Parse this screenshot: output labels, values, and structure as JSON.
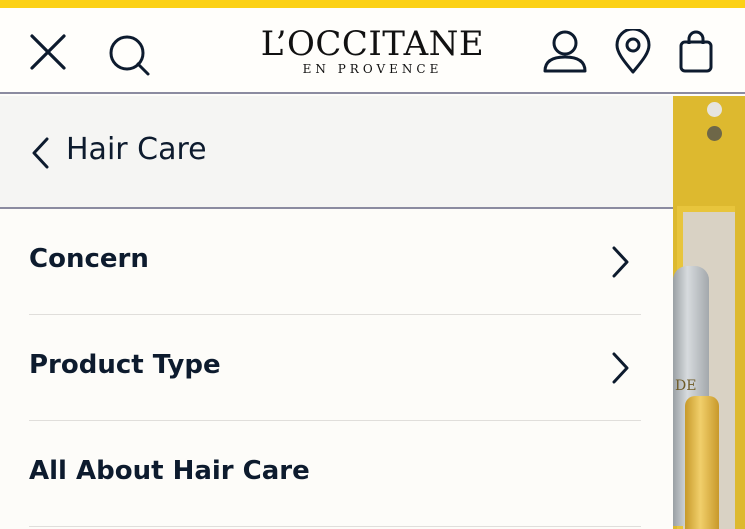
{
  "colors": {
    "accent": "#fcd116",
    "text": "#0d1b2e",
    "panel": "#f5f5f3",
    "divider": "#8b8ba0"
  },
  "header": {
    "logo_main": "L’OCCITANE",
    "logo_sub": "EN PROVENCE",
    "icons": [
      "close-icon",
      "search-icon",
      "account-icon",
      "store-locator-icon",
      "shopping-bag-icon"
    ]
  },
  "drawer": {
    "back_label": "Hair Care",
    "items": [
      {
        "label": "Concern",
        "has_submenu": true
      },
      {
        "label": "Product Type",
        "has_submenu": true
      },
      {
        "label": "All About Hair Care",
        "has_submenu": false
      }
    ]
  },
  "carousel": {
    "total_slides": 2,
    "active_slide": 2,
    "visible_label": "DE"
  }
}
